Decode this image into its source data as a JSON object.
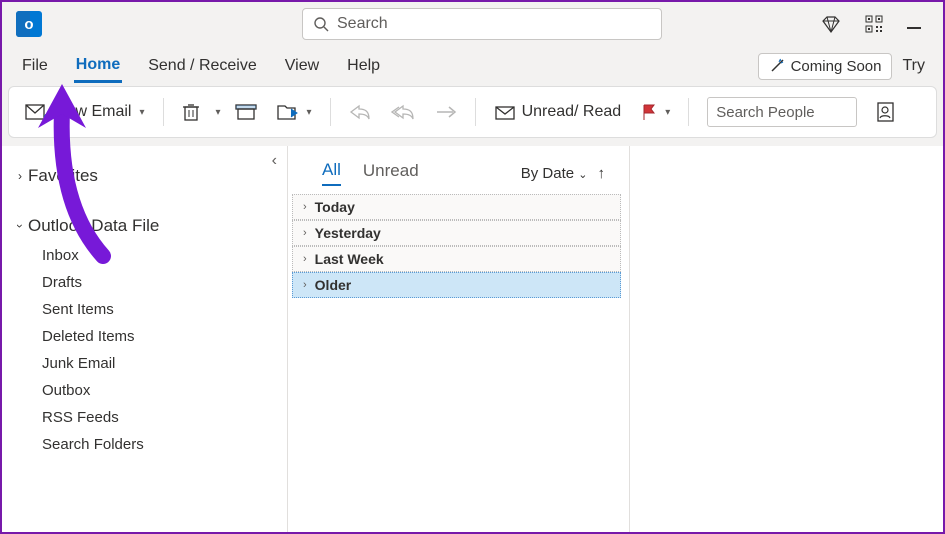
{
  "title": {
    "search_placeholder": "Search"
  },
  "menu": {
    "file": "File",
    "home": "Home",
    "send_receive": "Send / Receive",
    "view": "View",
    "help": "Help",
    "coming_soon": "Coming Soon",
    "try": "Try"
  },
  "ribbon": {
    "new_email": "New Email",
    "unread_read": "Unread/ Read",
    "search_people": "Search People"
  },
  "sidebar": {
    "favorites": "Favorites",
    "data_file": "Outlook Data File",
    "folders": [
      "Inbox",
      "Drafts",
      "Sent Items",
      "Deleted Items",
      "Junk Email",
      "Outbox",
      "RSS Feeds",
      "Search Folders"
    ]
  },
  "msglist": {
    "all": "All",
    "unread": "Unread",
    "by_date": "By Date",
    "groups": [
      "Today",
      "Yesterday",
      "Last Week",
      "Older"
    ]
  }
}
